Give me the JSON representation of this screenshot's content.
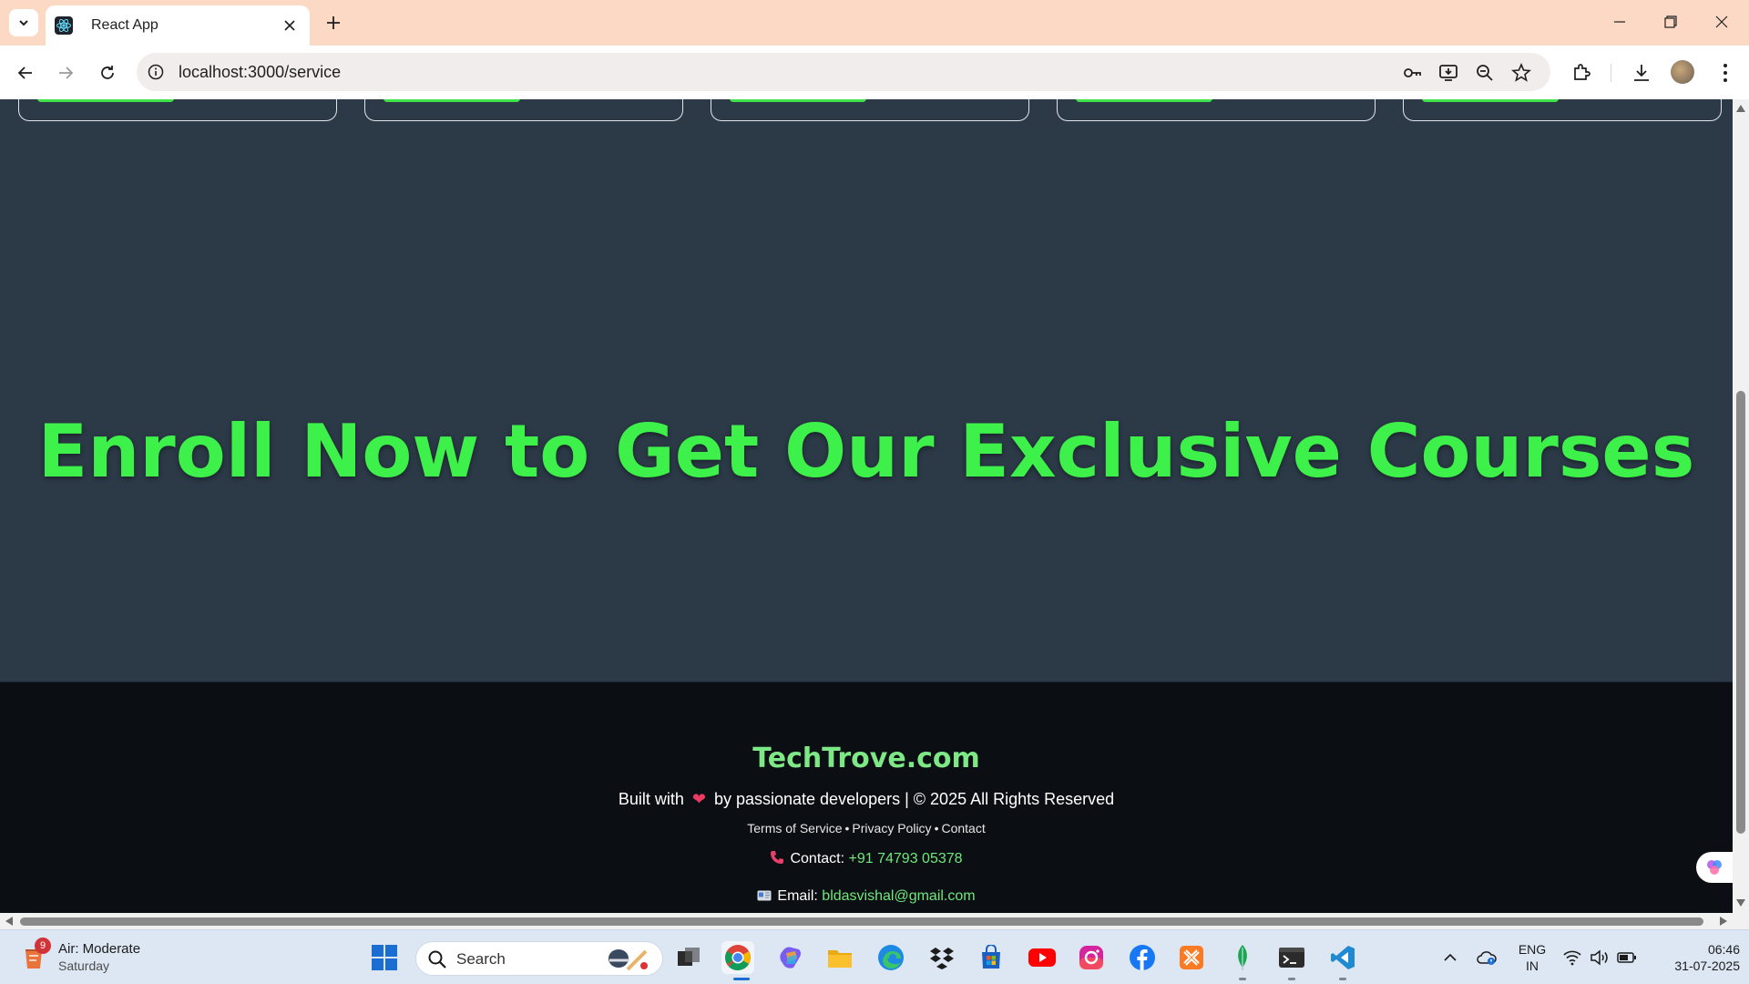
{
  "browser": {
    "tab_title": "React App",
    "url": "localhost:3000/service"
  },
  "page": {
    "hero_title": "Enroll Now to Get Our Exclusive Courses",
    "colors": {
      "accent_green": "#3ef04a",
      "page_bg": "#2c3a48",
      "footer_bg": "#0b0f14"
    }
  },
  "footer": {
    "brand": "TechTrove.com",
    "built_prefix": "Built with",
    "built_suffix": "by passionate developers | © 2025 All Rights Reserved",
    "links": [
      "Terms of Service",
      "Privacy Policy",
      "Contact"
    ],
    "link_separator": "•",
    "contact_label": "Contact:",
    "contact_value": "+91 74793 05378",
    "email_label": "Email:",
    "email_value": "bldasvishal@gmail.com"
  },
  "taskbar": {
    "weather_title": "Air: Moderate",
    "weather_sub": "Saturday",
    "weather_badge": "9",
    "search_placeholder": "Search",
    "lang_line1": "ENG",
    "lang_line2": "IN",
    "time": "06:46",
    "date": "31-07-2025"
  }
}
